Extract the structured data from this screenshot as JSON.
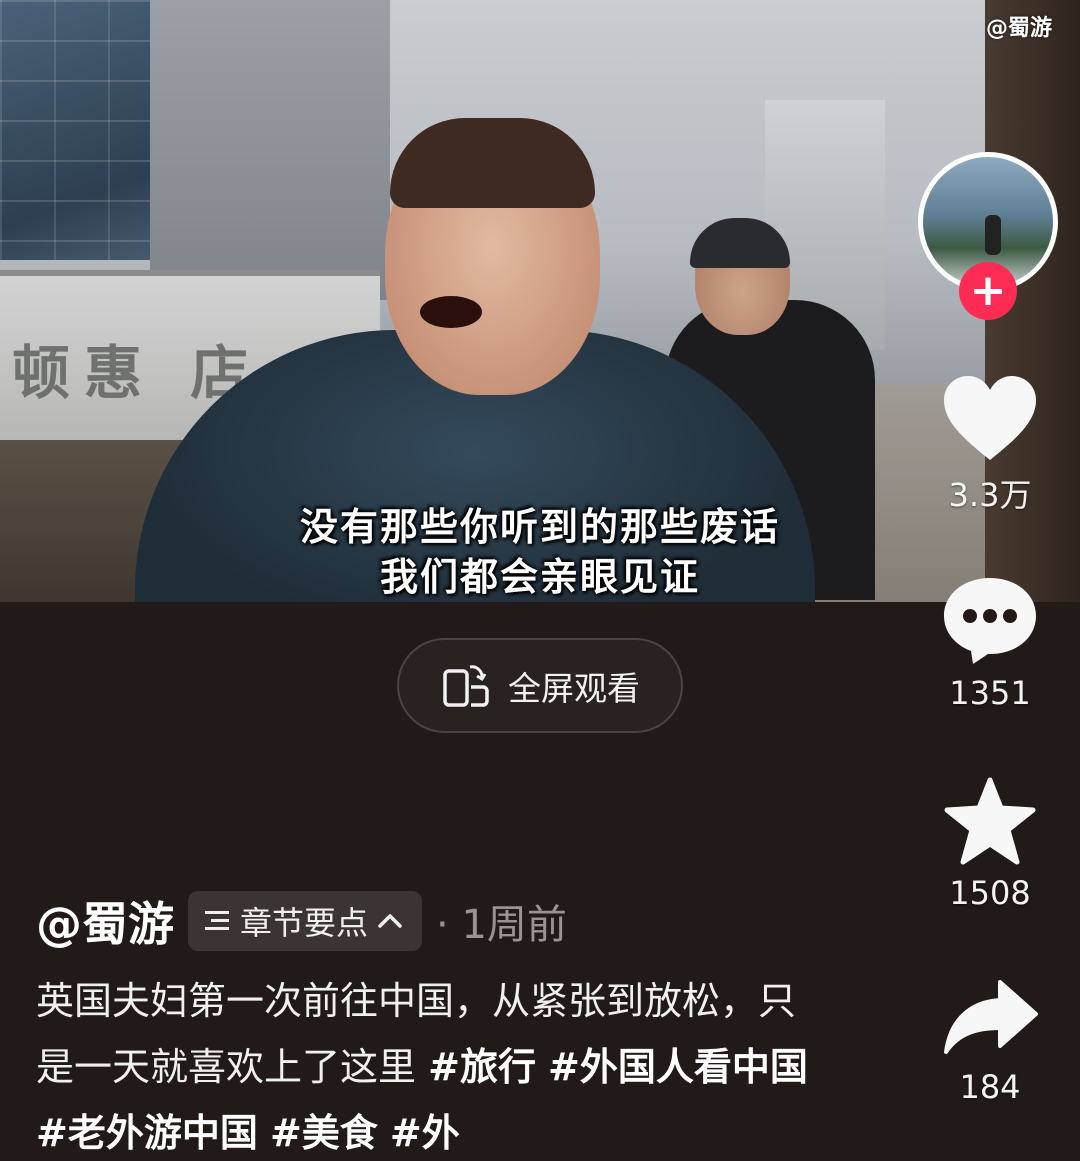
{
  "video": {
    "watermark": "@蜀游",
    "storefront_sign": "顿惠 店",
    "subtitle_line1": "没有那些你听到的那些废话",
    "subtitle_line2": "我们都会亲眼见证"
  },
  "fullscreen_button": {
    "label": "全屏观看",
    "icon": "rotate-screen-icon"
  },
  "actions": {
    "like": {
      "icon": "heart-icon",
      "count": "3.3万"
    },
    "comment": {
      "icon": "comment-bubble-icon",
      "count": "1351"
    },
    "favorite": {
      "icon": "star-icon",
      "count": "1508"
    },
    "share": {
      "icon": "share-arrow-icon",
      "count": "184"
    },
    "follow": {
      "icon": "plus-icon",
      "color": "#fe2c55"
    }
  },
  "post": {
    "author": "@蜀游",
    "chapter_chip": "章节要点",
    "time": "· 1周前",
    "caption_text": "英国夫妇第一次前往中国，从紧张到放松，只是一天就喜欢上了这里",
    "hashtags": [
      "#旅行",
      "#外国人看中国",
      "#老外游中国",
      "#美食",
      "#外"
    ]
  },
  "colors": {
    "background": "#221a18",
    "accent": "#fe2c55"
  }
}
